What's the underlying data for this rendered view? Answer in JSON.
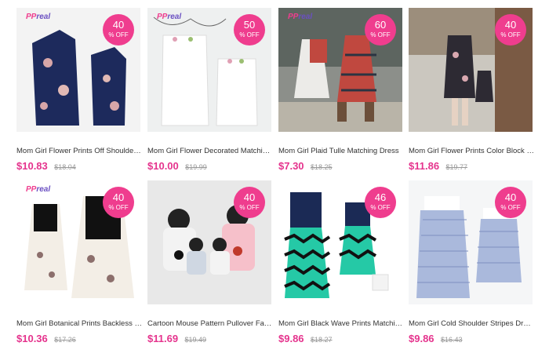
{
  "badge_off_label": "% OFF",
  "products": [
    {
      "title": "Mom Girl Flower Prints Off Shoulder Se...",
      "price": "$10.83",
      "orig": "$18.04",
      "discount": "40",
      "logo": true,
      "scene": "navy-floral"
    },
    {
      "title": "Mom Girl Flower Decorated Matching ...",
      "price": "$10.00",
      "orig": "$19.99",
      "discount": "50",
      "logo": true,
      "scene": "white-dress"
    },
    {
      "title": "Mom Girl Plaid Tulle Matching Dress",
      "price": "$7.30",
      "orig": "$18.25",
      "discount": "60",
      "logo": true,
      "scene": "plaid-photo"
    },
    {
      "title": "Mom Girl Flower Prints Color Block Mat...",
      "price": "$11.86",
      "orig": "$19.77",
      "discount": "40",
      "logo": false,
      "scene": "street-photo"
    },
    {
      "title": "Mom Girl Botanical Prints Backless Mat...",
      "price": "$10.36",
      "orig": "$17.26",
      "discount": "40",
      "logo": true,
      "scene": "botanical"
    },
    {
      "title": "Cartoon Mouse Pattern Pullover Family...",
      "price": "$11.69",
      "orig": "$19.49",
      "discount": "40",
      "logo": false,
      "scene": "family-backs"
    },
    {
      "title": "Mom Girl Black Wave Prints Matching ...",
      "price": "$9.86",
      "orig": "$18.27",
      "discount": "46",
      "logo": false,
      "scene": "wave-dress"
    },
    {
      "title": "Mom Girl Cold Shoulder Stripes Dress",
      "price": "$9.86",
      "orig": "$16.43",
      "discount": "40",
      "logo": false,
      "scene": "stripes-dress"
    }
  ],
  "brand": {
    "prefix": "PP",
    "suffix": "real"
  },
  "colors": {
    "accent": "#ef3d8e",
    "price": "#e5338d"
  }
}
